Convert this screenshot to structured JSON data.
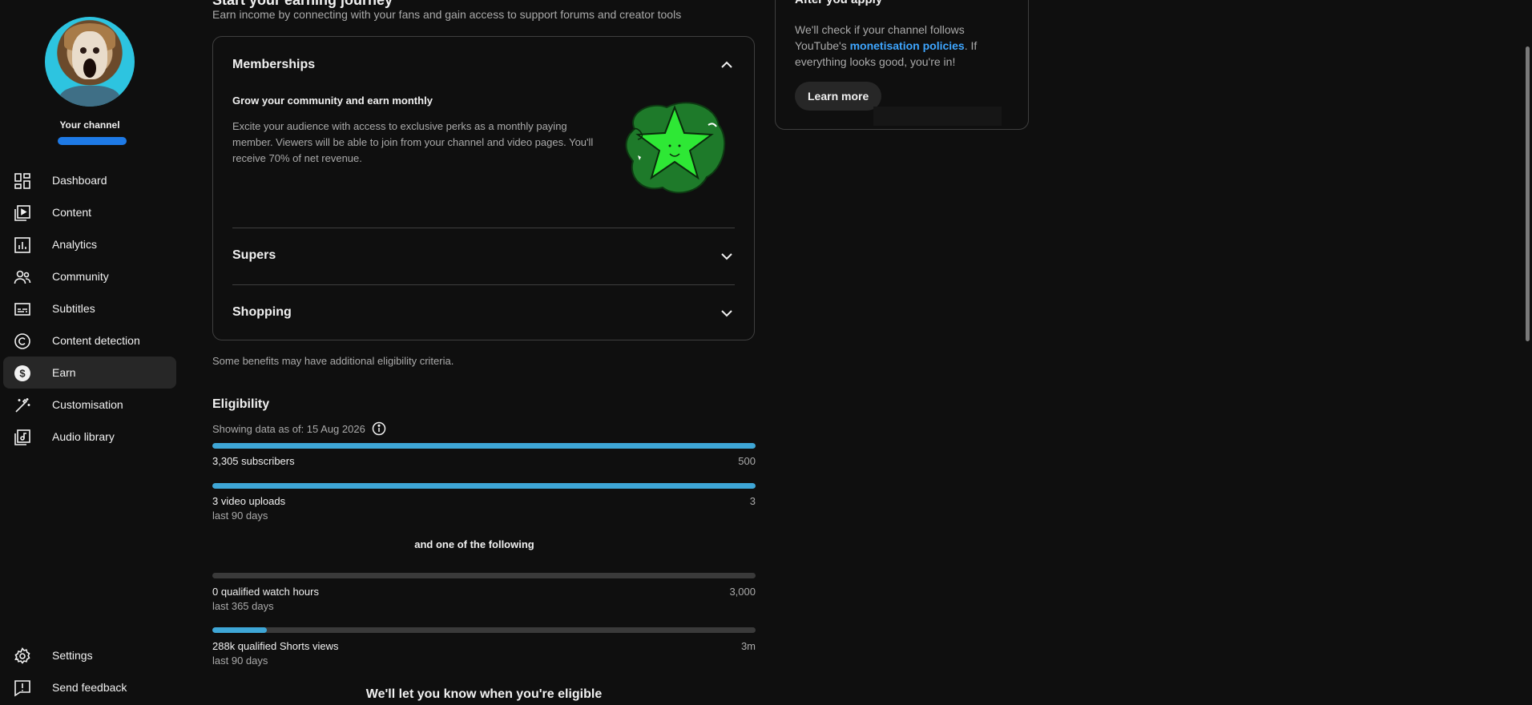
{
  "sidebar": {
    "channel_label": "Your channel",
    "items": [
      {
        "label": "Dashboard",
        "icon": "dashboard-icon"
      },
      {
        "label": "Content",
        "icon": "content-icon"
      },
      {
        "label": "Analytics",
        "icon": "analytics-icon"
      },
      {
        "label": "Community",
        "icon": "community-icon"
      },
      {
        "label": "Subtitles",
        "icon": "subtitles-icon"
      },
      {
        "label": "Content detection",
        "icon": "copyright-icon"
      },
      {
        "label": "Earn",
        "icon": "dollar-icon",
        "active": true
      },
      {
        "label": "Customisation",
        "icon": "magic-wand-icon"
      },
      {
        "label": "Audio library",
        "icon": "audio-library-icon"
      }
    ],
    "bottom_items": [
      {
        "label": "Settings",
        "icon": "gear-icon"
      },
      {
        "label": "Send feedback",
        "icon": "feedback-icon"
      }
    ]
  },
  "main": {
    "heading": "Start your earning journey",
    "subheading": "Earn income by connecting with your fans and gain access to support forums and creator tools",
    "accordion": {
      "memberships": {
        "title": "Memberships",
        "content_title": "Grow your community and earn monthly",
        "content_text": "Excite your audience with access to exclusive perks as a monthly paying member. Viewers will be able to join from your channel and video pages. You'll receive 70% of net revenue."
      },
      "supers": {
        "title": "Supers"
      },
      "shopping": {
        "title": "Shopping"
      }
    },
    "note": "Some benefits may have additional eligibility criteria.",
    "eligibility": {
      "title": "Eligibility",
      "showing": "Showing data as of: 15 Aug 2026",
      "metrics": [
        {
          "label": "3,305 subscribers",
          "sub": "",
          "target": "500",
          "progress": 1.0
        },
        {
          "label": "3 video uploads",
          "sub": "last 90 days",
          "target": "3",
          "progress": 1.0
        }
      ],
      "and_one": "and one of the following",
      "options": [
        {
          "label": "0 qualified watch hours",
          "sub": "last 365 days",
          "target": "3,000",
          "progress": 0.0
        },
        {
          "label": "288k qualified Shorts views",
          "sub": "last 90 days",
          "target": "3m",
          "progress": 0.1
        }
      ],
      "bottom": "We'll let you know when you're eligible"
    }
  },
  "right_panel": {
    "title": "After you apply",
    "text_before": "We'll check if your channel follows YouTube's ",
    "link": "monetisation policies",
    "text_after": ". If everything looks good, you're in!",
    "button": "Learn more"
  },
  "colors": {
    "background": "#0f0f0f",
    "accent": "#3ea6d6",
    "link": "#3ea6ff",
    "active_nav": "#272727"
  }
}
